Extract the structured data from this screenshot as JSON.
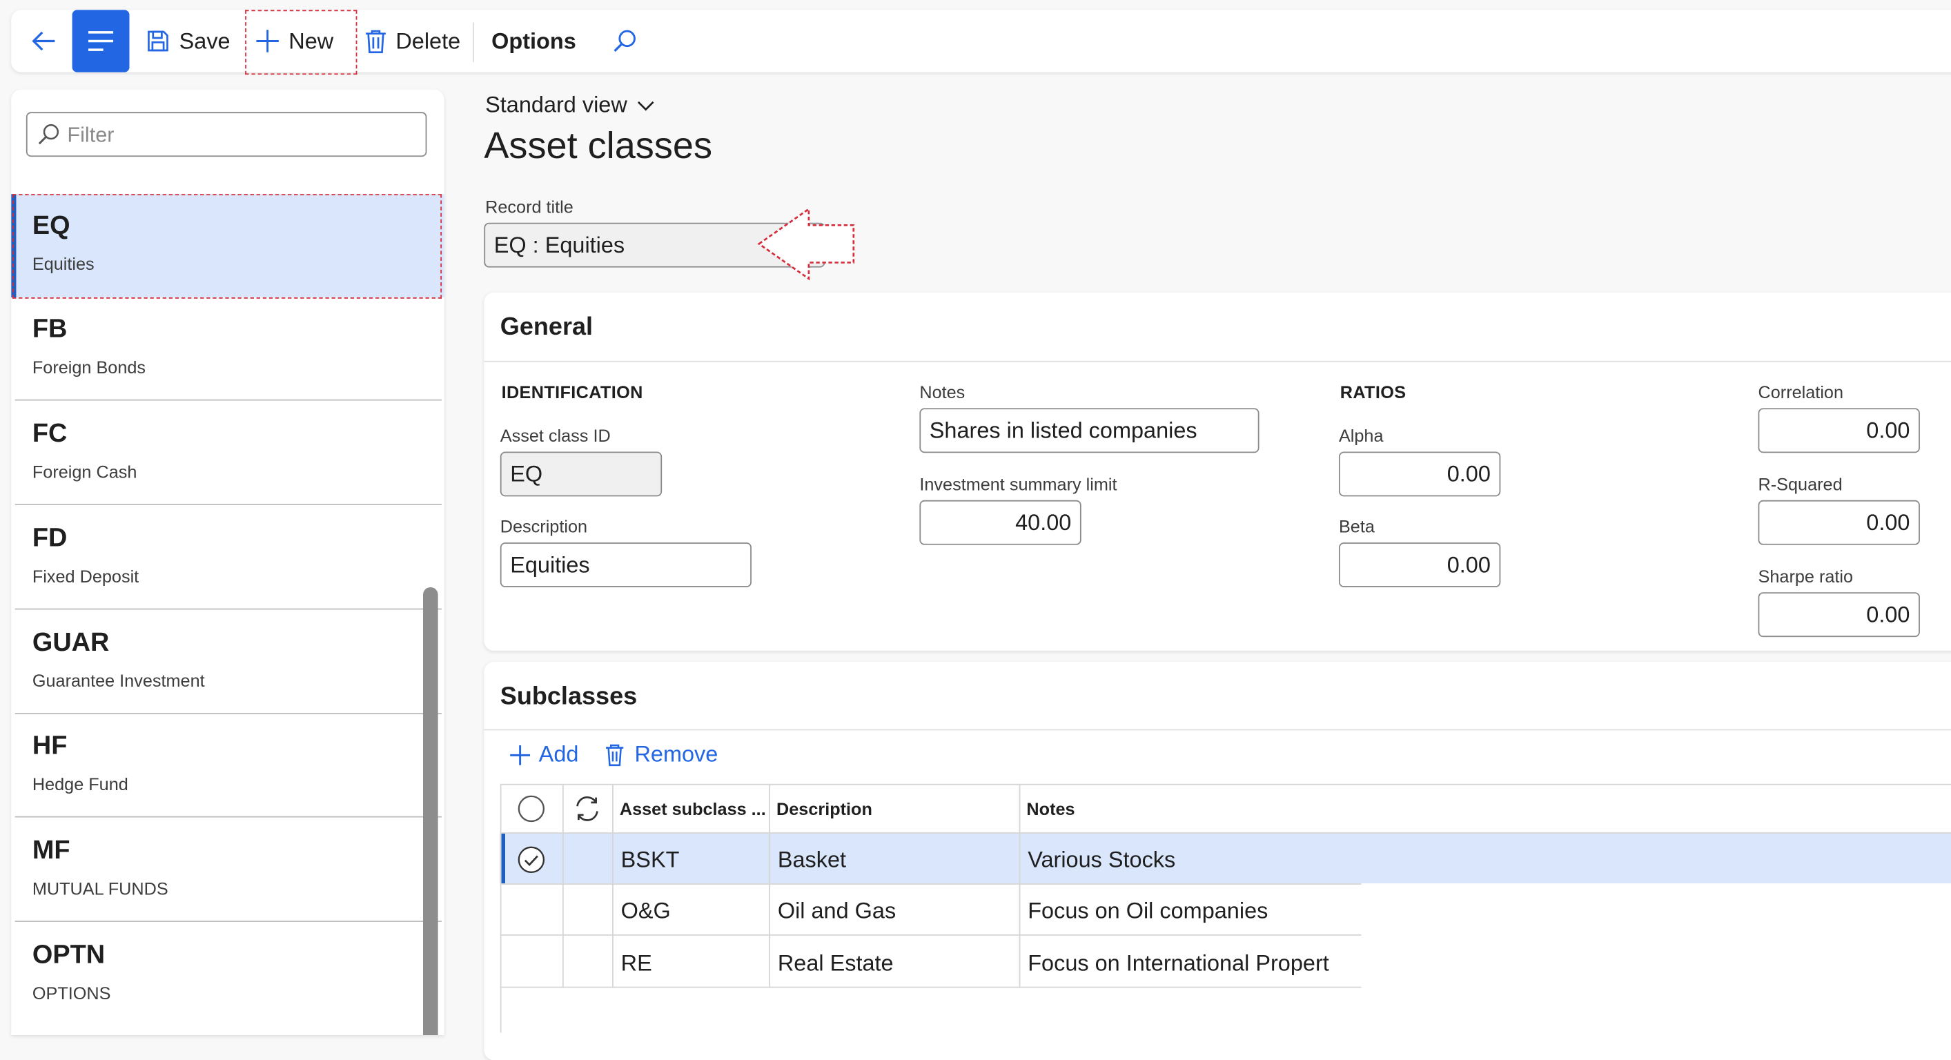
{
  "toolbar": {
    "save": "Save",
    "new": "New",
    "delete": "Delete",
    "options": "Options"
  },
  "list": {
    "filter_placeholder": "Filter",
    "items": [
      {
        "code": "EQ",
        "desc": "Equities"
      },
      {
        "code": "FB",
        "desc": "Foreign Bonds"
      },
      {
        "code": "FC",
        "desc": "Foreign Cash"
      },
      {
        "code": "FD",
        "desc": "Fixed Deposit"
      },
      {
        "code": "GUAR",
        "desc": "Guarantee Investment"
      },
      {
        "code": "HF",
        "desc": "Hedge Fund"
      },
      {
        "code": "MF",
        "desc": "MUTUAL FUNDS"
      },
      {
        "code": "OPTN",
        "desc": "OPTIONS"
      }
    ]
  },
  "header": {
    "view": "Standard view",
    "title": "Asset classes",
    "record_title_label": "Record title",
    "record_title_value": "EQ : Equities"
  },
  "general": {
    "title": "General",
    "identification": "IDENTIFICATION",
    "asset_class_id_label": "Asset class ID",
    "asset_class_id": "EQ",
    "description_label": "Description",
    "description": "Equities",
    "notes_label": "Notes",
    "notes": "Shares in listed companies",
    "inv_limit_label": "Investment summary limit",
    "inv_limit": "40.00",
    "ratios": "RATIOS",
    "alpha_label": "Alpha",
    "alpha": "0.00",
    "beta_label": "Beta",
    "beta": "0.00",
    "correlation_label": "Correlation",
    "correlation": "0.00",
    "rsquared_label": "R-Squared",
    "rsquared": "0.00",
    "sharpe_label": "Sharpe ratio",
    "sharpe": "0.00"
  },
  "subclasses": {
    "title": "Subclasses",
    "add": "Add",
    "remove": "Remove",
    "columns": [
      "Asset subclass ...",
      "Description",
      "Notes"
    ],
    "rows": [
      {
        "id": "BSKT",
        "desc": "Basket",
        "notes": "Various Stocks"
      },
      {
        "id": "O&G",
        "desc": "Oil and Gas",
        "notes": "Focus on Oil companies"
      },
      {
        "id": "RE",
        "desc": "Real Estate",
        "notes": "Focus on International Propert"
      }
    ]
  },
  "colors": {
    "accent": "#2266e3",
    "selection": "#d9e6fb",
    "highlight": "#d62d3c"
  }
}
